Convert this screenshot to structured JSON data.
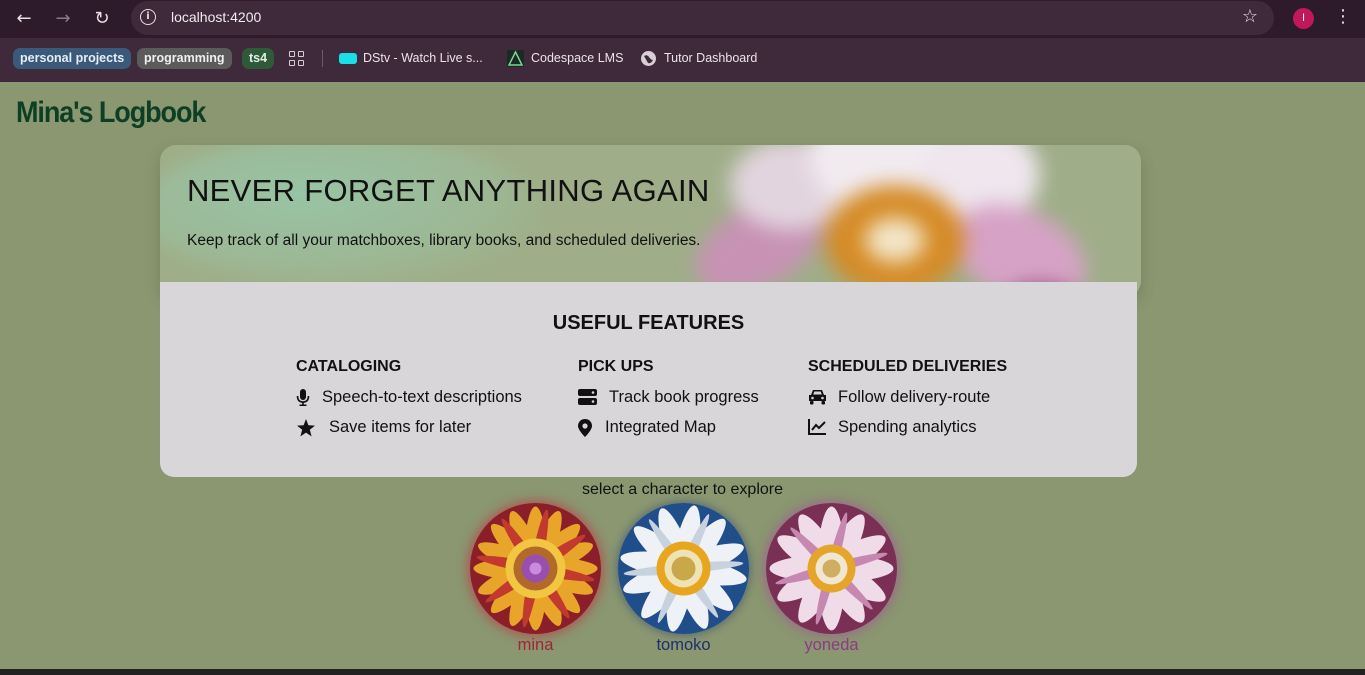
{
  "browser": {
    "url": "localhost:4200",
    "profile_initial": "I",
    "bookmarks": [
      {
        "label": "personal projects",
        "bg": "#3b5a7a",
        "color": "#e6eef8"
      },
      {
        "label": "programming",
        "bg": "#5b5b5b",
        "color": "#f0f0f0"
      },
      {
        "label": "ts4",
        "bg": "#2e5a3a",
        "color": "#e0f0e4"
      }
    ],
    "links": [
      "DStv - Watch Live s...",
      "Codespace LMS",
      "Tutor Dashboard"
    ]
  },
  "app": {
    "logo": "Mina's Logbook",
    "hero": {
      "title": "NEVER FORGET ANYTHING AGAIN",
      "subtitle": "Keep track of all your matchboxes, library books, and scheduled deliveries."
    },
    "features": {
      "title": "USEFUL FEATURES",
      "columns": [
        {
          "heading": "CATALOGING",
          "items": [
            {
              "icon": "microphone-icon",
              "label": "Speech-to-text descriptions"
            },
            {
              "icon": "star-icon",
              "label": "Save items for later"
            }
          ]
        },
        {
          "heading": "PICK UPS",
          "items": [
            {
              "icon": "server-icon",
              "label": "Track book progress"
            },
            {
              "icon": "map-pin-icon",
              "label": "Integrated Map"
            }
          ]
        },
        {
          "heading": "SCHEDULED DELIVERIES",
          "items": [
            {
              "icon": "car-icon",
              "label": "Follow delivery-route"
            },
            {
              "icon": "line-chart-icon",
              "label": "Spending analytics"
            }
          ]
        }
      ]
    },
    "character_prompt": "select a character to explore",
    "characters": [
      {
        "name": "mina",
        "color": "#a0253a"
      },
      {
        "name": "tomoko",
        "color": "#1f2f6e"
      },
      {
        "name": "yoneda",
        "color": "#8a3a86"
      }
    ],
    "colors": {
      "page_bg": "#8a9770",
      "logo": "#0e3f25",
      "card_bg": "#d8d6d8"
    }
  }
}
